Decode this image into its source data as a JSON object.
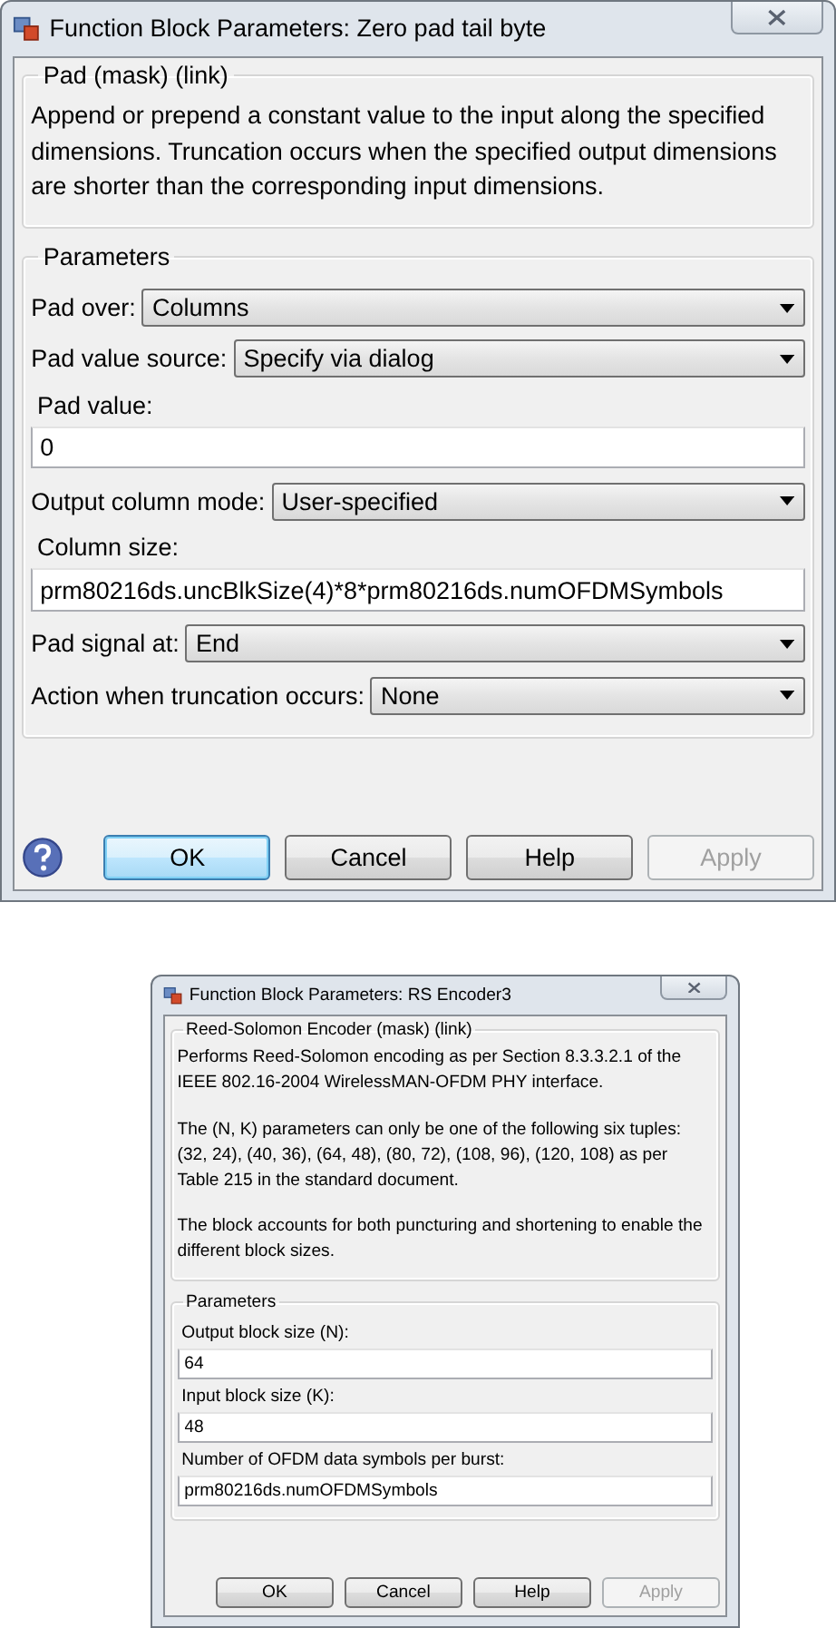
{
  "dialogs": [
    {
      "title": "Function Block Parameters: Zero pad tail byte",
      "mask_title": "Pad (mask) (link)",
      "description": [
        "Append or prepend a constant value to the input along the specified dimensions.  Truncation occurs when the specified output dimensions are shorter than the corresponding input dimensions."
      ],
      "parameters_title": "Parameters",
      "parameters": [
        {
          "kind": "dropdown",
          "label": "Pad over:",
          "value": "Columns"
        },
        {
          "kind": "dropdown",
          "label": "Pad value source:",
          "value": "Specify via dialog"
        },
        {
          "kind": "edit",
          "label": "Pad value:",
          "value": "0"
        },
        {
          "kind": "dropdown",
          "label": "Output column mode:",
          "value": "User-specified"
        },
        {
          "kind": "edit",
          "label": "Column size:",
          "value": "prm80216ds.uncBlkSize(4)*8*prm80216ds.numOFDMSymbols"
        },
        {
          "kind": "dropdown",
          "label": "Pad signal at:",
          "value": "End"
        },
        {
          "kind": "dropdown",
          "label": "Action when truncation occurs:",
          "value": "None"
        }
      ],
      "help_icon": true,
      "buttons": [
        {
          "label": "OK",
          "default": true,
          "disabled": false
        },
        {
          "label": "Cancel",
          "default": false,
          "disabled": false
        },
        {
          "label": "Help",
          "default": false,
          "disabled": false
        },
        {
          "label": "Apply",
          "default": false,
          "disabled": true
        }
      ]
    },
    {
      "title": "Function Block Parameters: RS Encoder3",
      "mask_title": "Reed-Solomon Encoder (mask) (link)",
      "description": [
        "Performs Reed-Solomon encoding as per Section 8.3.3.2.1 of the IEEE 802.16-2004 WirelessMAN-OFDM PHY interface.",
        "The (N, K) parameters can only be one of the following six tuples: (32, 24), (40, 36), (64, 48), (80, 72), (108, 96), (120, 108) as per Table 215 in the standard document.",
        "The block accounts for both puncturing and shortening to enable the different block sizes."
      ],
      "parameters_title": "Parameters",
      "parameters": [
        {
          "kind": "edit",
          "label": "Output block size (N):",
          "value": "64"
        },
        {
          "kind": "edit",
          "label": "Input block size (K):",
          "value": "48"
        },
        {
          "kind": "edit",
          "label": "Number of OFDM data symbols per burst:",
          "value": "prm80216ds.numOFDMSymbols"
        }
      ],
      "help_icon": false,
      "buttons": [
        {
          "label": "OK",
          "default": false,
          "disabled": false
        },
        {
          "label": "Cancel",
          "default": false,
          "disabled": false
        },
        {
          "label": "Help",
          "default": false,
          "disabled": false
        },
        {
          "label": "Apply",
          "default": false,
          "disabled": true
        }
      ]
    }
  ]
}
